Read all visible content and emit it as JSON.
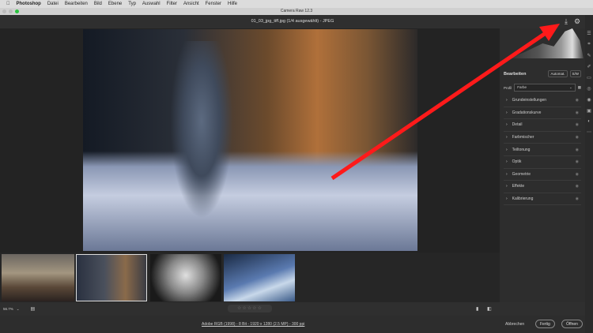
{
  "menubar": {
    "app": "Photoshop",
    "items": [
      "Datei",
      "Bearbeiten",
      "Bild",
      "Ebene",
      "Typ",
      "Auswahl",
      "Filter",
      "Ansicht",
      "Fenster",
      "Hilfe"
    ]
  },
  "window": {
    "title": "Camera Raw 12.3",
    "filename": "01_03_jpg_tiff.jpg (1/4 ausgewählt) - JPEG"
  },
  "panel": {
    "title": "Bearbeiten",
    "auto": "Automat.",
    "bw": "S/W",
    "profile_label": "Profil",
    "profile_value": "Farbe",
    "sections": [
      "Grundeinstellungen",
      "Gradationskurve",
      "Detail",
      "Farbmischer",
      "Teiltonung",
      "Optik",
      "Geometrie",
      "Effekte",
      "Kalibrierung"
    ]
  },
  "bottom": {
    "zoom": "56.7%",
    "stars": "☆☆☆☆☆"
  },
  "footer": {
    "info": "Adobe RGB (1998) - 8 Bit - 1920 x 1280 (2.5 MP) - 300 ppi",
    "cancel": "Abbrechen",
    "done": "Fertig",
    "open": "Öffnen"
  },
  "colors": {
    "arrow": "#ff1a1a"
  }
}
